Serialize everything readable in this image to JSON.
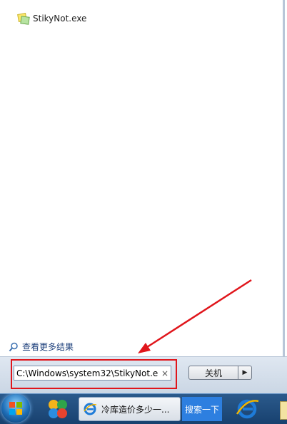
{
  "results": {
    "program_label": "StikyNot.exe",
    "program_icon": "sticky-notes-icon",
    "more_results_label": "查看更多结果",
    "more_results_icon": "search-icon"
  },
  "search": {
    "value": "C:\\Windows\\system32\\StikyNot.e",
    "clear_glyph": "×"
  },
  "power": {
    "shutdown_label": "关机",
    "arrow_glyph": "▶"
  },
  "taskbar": {
    "ie_window_title": "冷库造价多少一...",
    "search_button_label": "搜索一下",
    "pinned_icons": [
      "start-orb-icon",
      "app-icon",
      "ie-icon"
    ]
  },
  "colors": {
    "highlight": "#e0151b",
    "annotation_arrow": "#e0151b",
    "taskbar": "#17406e",
    "search_task": "#2d7fe0"
  }
}
